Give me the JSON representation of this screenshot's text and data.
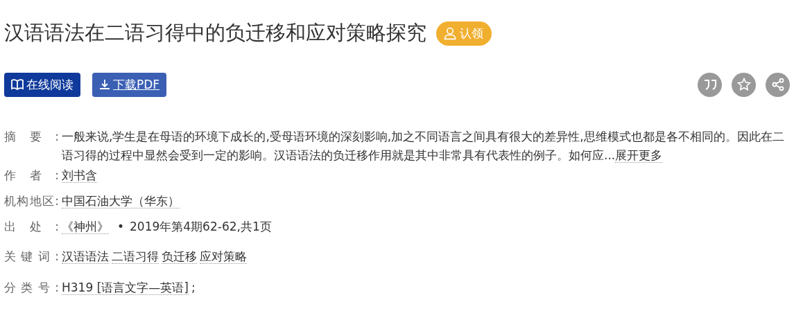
{
  "title": "汉语语法在二语习得中的负迁移和应对策略探究",
  "claim_badge": "认领",
  "actions": [
    {
      "kind": "read",
      "label": "在线阅读"
    },
    {
      "kind": "download",
      "label": "下载PDF"
    }
  ],
  "tools": [
    {
      "kind": "cite"
    },
    {
      "kind": "favorite"
    },
    {
      "kind": "share"
    }
  ],
  "fields": [
    {
      "kind": "abstract",
      "label": "摘要:",
      "text": "一般来说,学生是在母语的环境下成长的,受母语环境的深刻影响,加之不同语言之间具有很大的差异性,思维模式也都是各不相同的。因此在二语习得的过程中显然会受到一定的影响。汉语语法的负迁移作用就是其中非常具有代表性的例子。如何应...",
      "more": "展开更多"
    },
    {
      "kind": "links",
      "label": "作者:",
      "links": [
        "刘书含"
      ]
    },
    {
      "kind": "links",
      "label": "机构地区:",
      "links": [
        "中国石油大学（华东）"
      ]
    },
    {
      "kind": "source",
      "label": "出处:",
      "journal": "《神州》",
      "separator": "•",
      "detail": "2019年第4期62-62,共1页"
    },
    {
      "kind": "links",
      "label": "关键词:",
      "links": [
        "汉语语法",
        "二语习得",
        "负迁移",
        "应对策略"
      ]
    },
    {
      "kind": "classification",
      "label": "分类号:",
      "link": "H319 [语言文字—英语]",
      "suffix": ";"
    }
  ]
}
